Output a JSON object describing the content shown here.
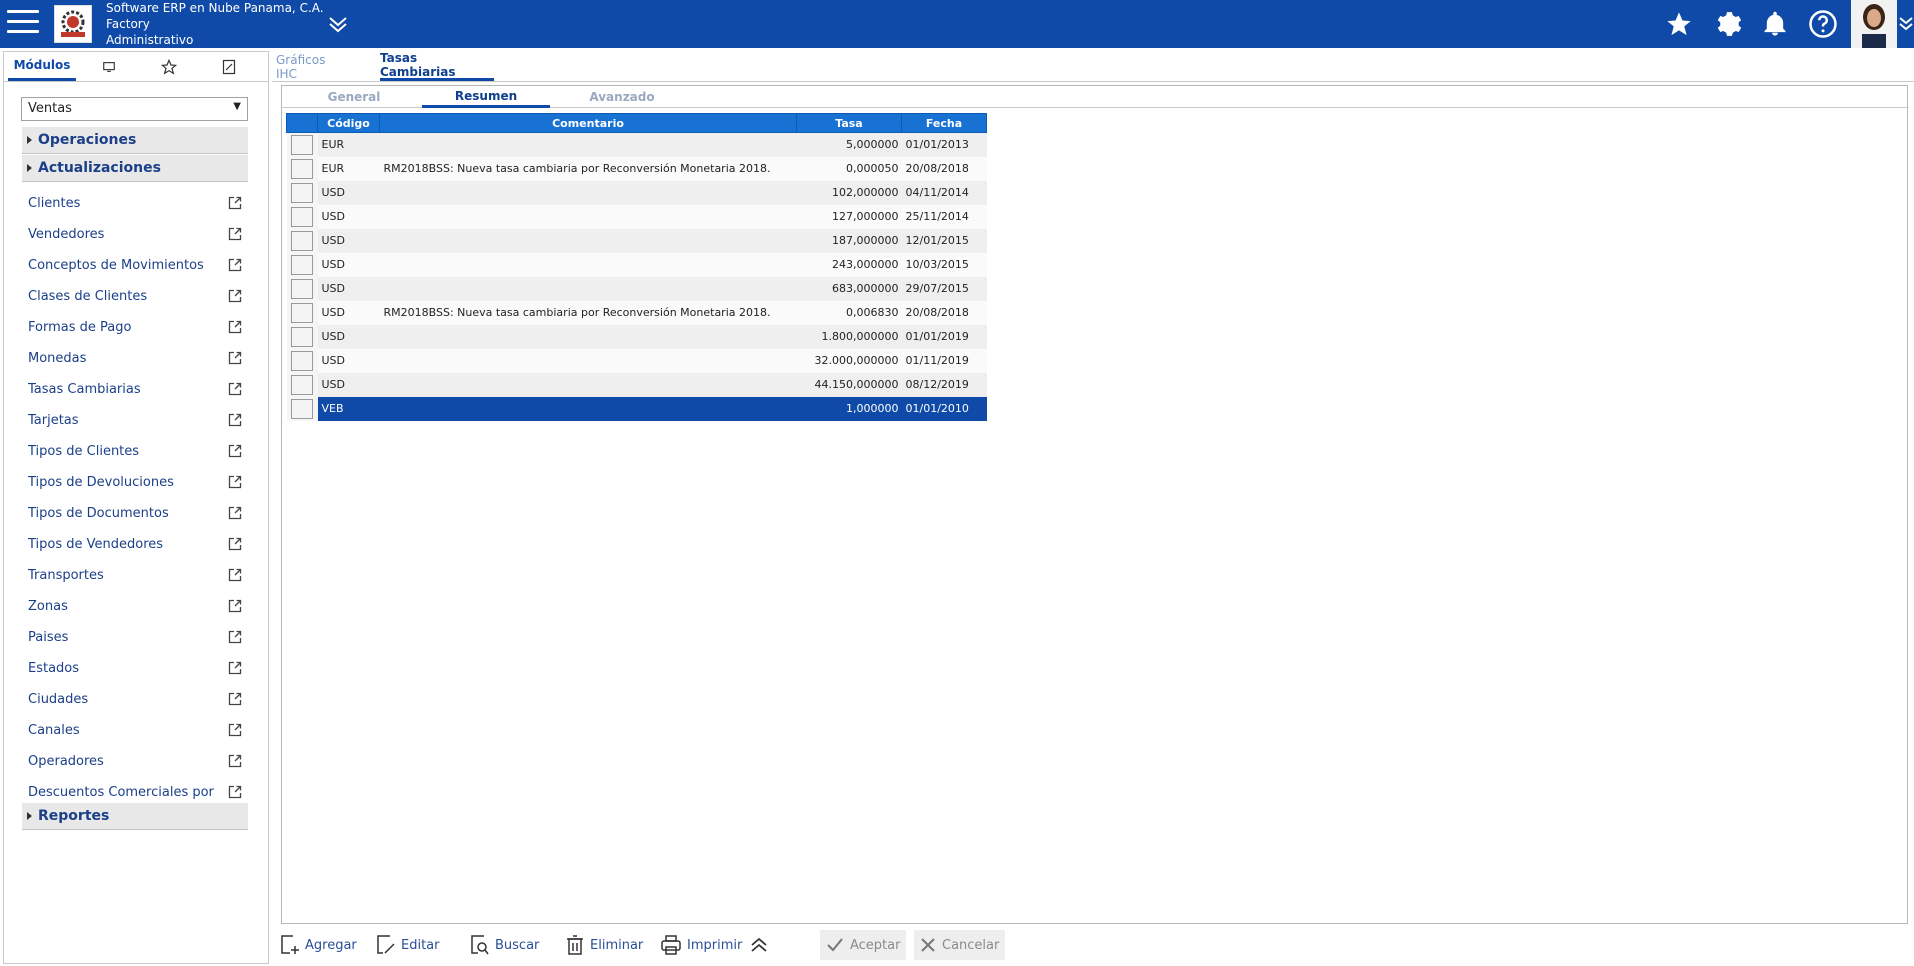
{
  "header": {
    "company_line1": "Software ERP en Nube Panama, C.A.",
    "company_line2": "Factory",
    "company_line3": "Administrativo"
  },
  "sidebar": {
    "tabs": [
      {
        "label": "Módulos",
        "icon": "modules-tab"
      },
      {
        "label": "",
        "icon": "monitor-icon"
      },
      {
        "label": "",
        "icon": "star-icon"
      },
      {
        "label": "",
        "icon": "document-edit-icon"
      }
    ],
    "module_select": "Ventas",
    "groups": {
      "operaciones": "Operaciones",
      "actualizaciones": "Actualizaciones",
      "reportes": "Reportes"
    },
    "items": [
      "Clientes",
      "Vendedores",
      "Conceptos de Movimientos",
      "Clases de Clientes",
      "Formas de Pago",
      "Monedas",
      "Tasas Cambiarias",
      "Tarjetas",
      "Tipos de Clientes",
      "Tipos de Devoluciones",
      "Tipos de Documentos",
      "Tipos de Vendedores",
      "Transportes",
      "Zonas",
      "Paises",
      "Estados",
      "Ciudades",
      "Canales",
      "Operadores",
      "Descuentos Comerciales por Cliente"
    ]
  },
  "main_tabs": [
    "Gráficos IHC",
    "Tasas Cambiarias"
  ],
  "sub_tabs": [
    "General",
    "Resumen",
    "Avanzado"
  ],
  "table": {
    "columns": [
      "Código",
      "Comentario",
      "Tasa",
      "Fecha"
    ],
    "rows": [
      {
        "codigo": "EUR",
        "comentario": "",
        "tasa": "5,000000",
        "fecha": "01/01/2013"
      },
      {
        "codigo": "EUR",
        "comentario": "RM2018BSS: Nueva tasa cambiaria por Reconversión Monetaria 2018.",
        "tasa": "0,000050",
        "fecha": "20/08/2018"
      },
      {
        "codigo": "USD",
        "comentario": "",
        "tasa": "102,000000",
        "fecha": "04/11/2014"
      },
      {
        "codigo": "USD",
        "comentario": "",
        "tasa": "127,000000",
        "fecha": "25/11/2014"
      },
      {
        "codigo": "USD",
        "comentario": "",
        "tasa": "187,000000",
        "fecha": "12/01/2015"
      },
      {
        "codigo": "USD",
        "comentario": "",
        "tasa": "243,000000",
        "fecha": "10/03/2015"
      },
      {
        "codigo": "USD",
        "comentario": "",
        "tasa": "683,000000",
        "fecha": "29/07/2015"
      },
      {
        "codigo": "USD",
        "comentario": "RM2018BSS: Nueva tasa cambiaria por Reconversión Monetaria 2018.",
        "tasa": "0,006830",
        "fecha": "20/08/2018"
      },
      {
        "codigo": "USD",
        "comentario": "",
        "tasa": "1.800,000000",
        "fecha": "01/01/2019"
      },
      {
        "codigo": "USD",
        "comentario": "",
        "tasa": "32.000,000000",
        "fecha": "01/11/2019"
      },
      {
        "codigo": "USD",
        "comentario": "",
        "tasa": "44.150,000000",
        "fecha": "08/12/2019"
      },
      {
        "codigo": "VEB",
        "comentario": "",
        "tasa": "1,000000",
        "fecha": "01/01/2010",
        "selected": true
      }
    ]
  },
  "toolbar": {
    "agregar": "Agregar",
    "editar": "Editar",
    "buscar": "Buscar",
    "eliminar": "Eliminar",
    "imprimir": "Imprimir",
    "aceptar": "Aceptar",
    "cancelar": "Cancelar"
  },
  "colors": {
    "header_bg": "#0f4aa8",
    "grid_header": "#1772d4",
    "selected_row": "#0f4aa8"
  }
}
